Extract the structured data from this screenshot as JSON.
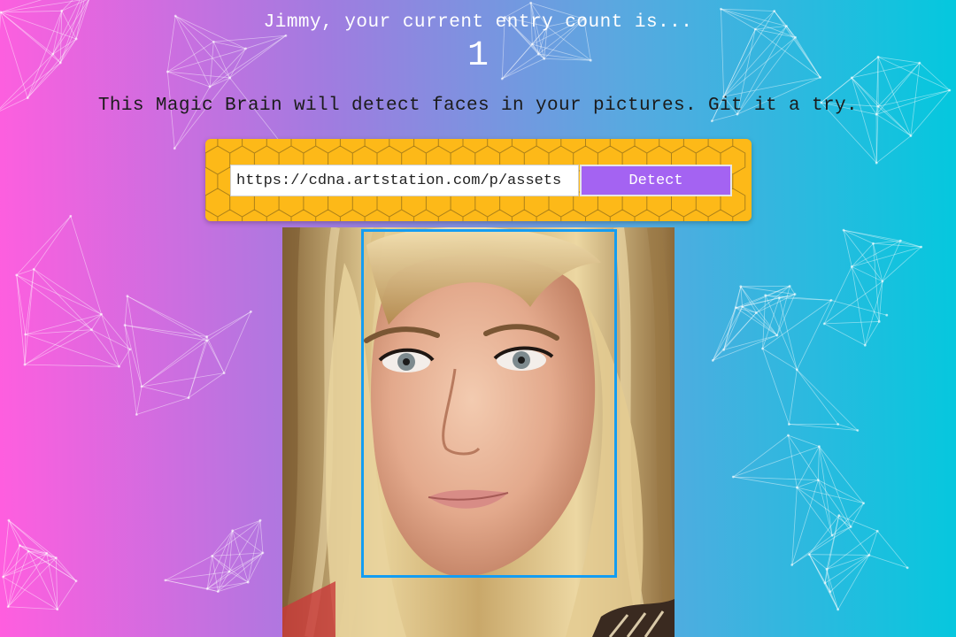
{
  "header": {
    "greeting": "Jimmy, your current entry count is...",
    "entry_count": "1"
  },
  "description": "This Magic Brain will detect faces in your pictures. Git it a try.",
  "form": {
    "url_value": "https://cdna.artstation.com/p/assets",
    "detect_label": "Detect"
  },
  "colors": {
    "gradient_left": "#ff5edf",
    "gradient_right": "#04c8de",
    "panel": "#fdb918",
    "button": "#a463f2",
    "bounding_box": "#149df2"
  },
  "result": {
    "faces_detected": 1
  }
}
